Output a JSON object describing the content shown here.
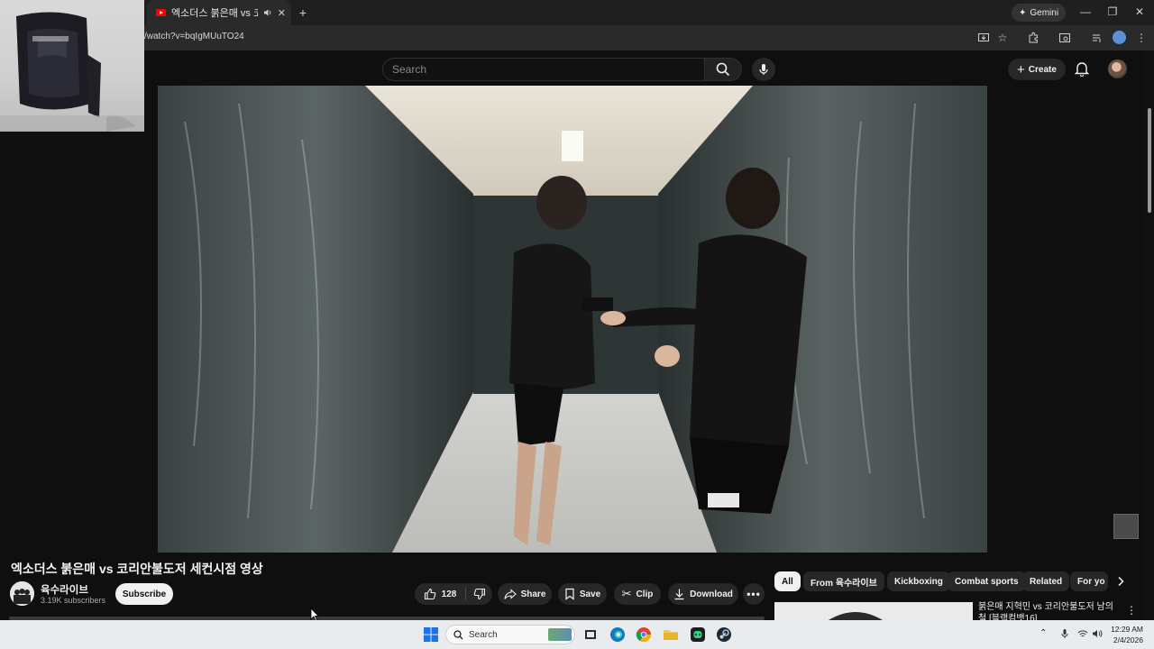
{
  "browser": {
    "tab_title": "엑소더스 붉은매 vs 코리안불도저",
    "new_tab": "+",
    "gemini_label": "Gemini",
    "url": "/watch?v=bqIgMUuTO24",
    "window_controls": [
      "—",
      "❐",
      "✕"
    ]
  },
  "masthead": {
    "search_placeholder": "Search",
    "create_label": "Create"
  },
  "video": {
    "title": "엑소더스 붉은매 vs 코리안불도저 세컨시점 영상",
    "channel_name": "육수라이브",
    "subscriber_count": "3.19K subscribers",
    "subscribe_label": "Subscribe",
    "like_count": "128",
    "actions": {
      "share": "Share",
      "save": "Save",
      "clip": "Clip",
      "download": "Download"
    }
  },
  "chips": [
    "All",
    "From 육수라이브",
    "Kickboxing",
    "Combat sports",
    "Related",
    "For yo"
  ],
  "recommendation": {
    "title": "붉은매 지혁민 vs 코리안불도저 남의철 [블랙컴뱃16]"
  },
  "taskbar": {
    "search_label": "Search",
    "time": "12:29 AM",
    "date": "2/4/2026"
  },
  "colors": {
    "background": "#0f0f0f",
    "youtube_red": "#ff0000",
    "chip_active": "#f1f1f1",
    "taskbar": "#e9ecef"
  }
}
